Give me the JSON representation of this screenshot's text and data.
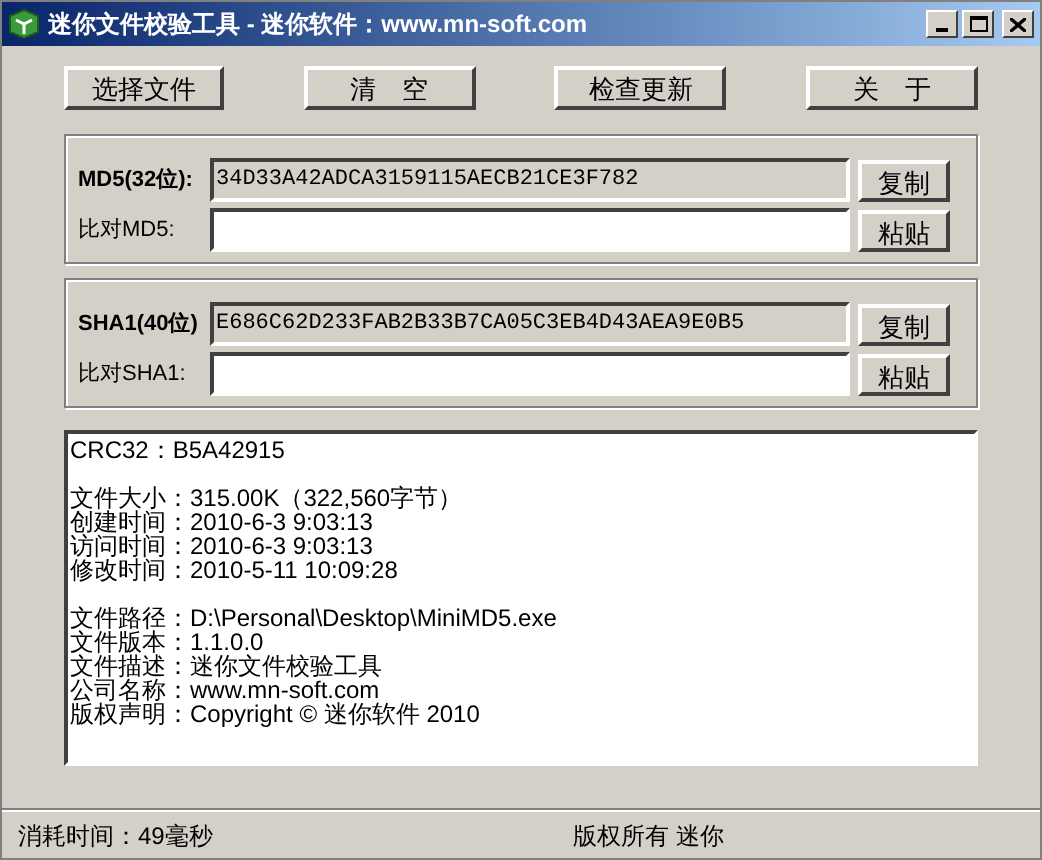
{
  "window": {
    "title": "迷你文件校验工具 - 迷你软件：www.mn-soft.com"
  },
  "buttons": [
    "选择文件",
    "清　空",
    "检查更新",
    "关　于"
  ],
  "hash_groups": [
    {
      "label": "MD5(32位):",
      "value": "34D33A42ADCA3159115AECB21CE3F782",
      "compare_label": "比对MD5:",
      "copy_button": "复制",
      "paste_button": "粘贴"
    },
    {
      "label": "SHA1(40位)",
      "value": "E686C62D233FAB2B33B7CA05C3EB4D43AEA9E0B5",
      "compare_label": "比对SHA1:",
      "copy_button": "复制",
      "paste_button": "粘贴"
    }
  ],
  "info": {
    "sections": [
      [
        "CRC32：B5A42915"
      ],
      [
        "文件大小：315.00K（322,560字节）",
        "创建时间：2010-6-3 9:03:13",
        "访问时间：2010-6-3 9:03:13",
        "修改时间：2010-5-11 10:09:28"
      ],
      [
        "文件路径：D:\\Personal\\Desktop\\MiniMD5.exe",
        "文件版本：1.1.0.0",
        "文件描述：迷你文件校验工具",
        "公司名称：www.mn-soft.com",
        "版权声明：Copyright © 迷你软件 2010"
      ]
    ]
  },
  "status_bar": {
    "left": "消耗时间：49毫秒",
    "right": "版权所有 迷你"
  }
}
